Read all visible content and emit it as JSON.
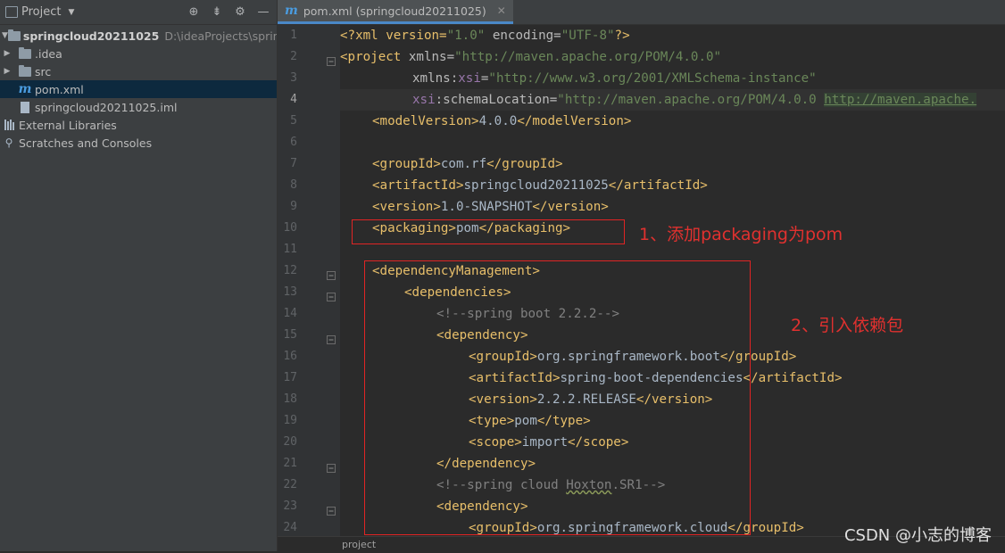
{
  "project_panel": {
    "title": "Project",
    "tree": [
      {
        "label": "springcloud20211025",
        "path": "D:\\ideaProjects\\springclou",
        "kind": "module"
      },
      {
        "label": ".idea",
        "kind": "folder"
      },
      {
        "label": "src",
        "kind": "folder"
      },
      {
        "label": "pom.xml",
        "kind": "maven"
      },
      {
        "label": "springcloud20211025.iml",
        "kind": "file"
      },
      {
        "label": "External Libraries",
        "kind": "libs"
      },
      {
        "label": "Scratches and Consoles",
        "kind": "scratch"
      }
    ]
  },
  "editor": {
    "tab_icon": "m",
    "tab_label": "pom.xml (springcloud20211025)",
    "current_line": 4,
    "line_numbers": [
      "1",
      "2",
      "3",
      "4",
      "5",
      "6",
      "7",
      "8",
      "9",
      "10",
      "11",
      "12",
      "13",
      "14",
      "15",
      "16",
      "17",
      "18",
      "19",
      "20",
      "21",
      "22",
      "23",
      "24"
    ],
    "breadcrumb": "project",
    "code": {
      "l1_decl_open": "<?xml version=",
      "l1_ver": "\"1.0\"",
      "l1_enc": " encoding=",
      "l1_enc_val": "\"UTF-8\"",
      "l1_close": "?>",
      "l2_tag": "<project",
      "l2_attr": " xmlns=",
      "l2_val": "\"http://maven.apache.org/POM/4.0.0\"",
      "l3_attr": "xmlns:",
      "l3_ns": "xsi",
      "l3_eq": "=",
      "l3_val": "\"http://www.w3.org/2001/XMLSchema-instance\"",
      "l4_ns": "xsi",
      "l4_attr": ":schemaLocation=",
      "l4_val": "\"http://maven.apache.org/POM/4.0.0 ",
      "l4_url": "http://maven.apache.",
      "l5_open": "<modelVersion>",
      "l5_text": "4.0.0",
      "l5_close": "</modelVersion>",
      "l7_open": "<groupId>",
      "l7_text": "com.rf",
      "l7_close": "</groupId>",
      "l8_open": "<artifactId>",
      "l8_text": "springcloud20211025",
      "l8_close": "</artifactId>",
      "l9_open": "<version>",
      "l9_text": "1.0-SNAPSHOT",
      "l9_close": "</version>",
      "l10_open": "<packaging>",
      "l10_text": "pom",
      "l10_close": "</packaging>",
      "l12": "<dependencyManagement>",
      "l13": "<dependencies>",
      "l14": "<!--spring boot 2.2.2-->",
      "l15": "<dependency>",
      "l16_open": "<groupId>",
      "l16_text": "org.springframework.boot",
      "l16_close": "</groupId>",
      "l17_open": "<artifactId>",
      "l17_text": "spring-boot-dependencies",
      "l17_close": "</artifactId>",
      "l18_open": "<version>",
      "l18_text": "2.2.2.RELEASE",
      "l18_close": "</version>",
      "l19_open": "<type>",
      "l19_text": "pom",
      "l19_close": "</type>",
      "l20_open": "<scope>",
      "l20_text": "import",
      "l20_close": "</scope>",
      "l21": "</dependency>",
      "l22_a": "<!--spring cloud ",
      "l22_b": "Hoxton",
      "l22_c": ".SR1-->",
      "l23": "<dependency>",
      "l24_open": "<groupId>",
      "l24_text": "org.springframework.cloud",
      "l24_close": "</groupId>"
    }
  },
  "annotations": {
    "note1": "1、添加packaging为pom",
    "note2": "2、引入依赖包"
  },
  "watermark": "CSDN @小志的博客",
  "colors": {
    "annotation": "#e02424",
    "tag": "#e8bf6a",
    "string": "#6a8759",
    "comment": "#808080"
  }
}
